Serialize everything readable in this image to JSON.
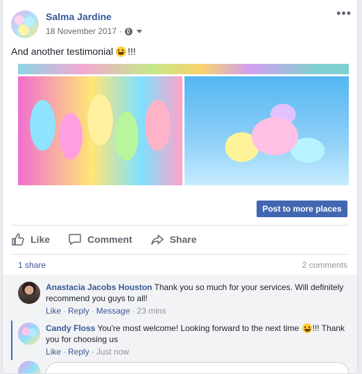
{
  "post": {
    "author": "Salma Jardine",
    "date": "18 November 2017",
    "meta_dot": "·",
    "more_icon": "•••",
    "text": "And another testimonial",
    "text_suffix": "!!!"
  },
  "boost_button": "Post to more places",
  "actions": {
    "like": "Like",
    "comment": "Comment",
    "share": "Share"
  },
  "stats": {
    "shares": "1 share",
    "comments": "2 comments"
  },
  "comments": [
    {
      "name": "Anastacia Jacobs Houston",
      "text": "Thank you so much for your services. Will definitely recommend you guys to all!",
      "like": "Like",
      "reply": "Reply",
      "message": "Message",
      "time": "23 mins"
    },
    {
      "name": "Candy Floss",
      "text_before": "You're most welcome! Looking forward to the next time",
      "text_after": "!!! Thank you for choosing us",
      "like": "Like",
      "reply": "Reply",
      "time": "Just now"
    }
  ],
  "colors": {
    "link": "#385898",
    "button": "#4267b2",
    "background": "#e9ebee"
  }
}
